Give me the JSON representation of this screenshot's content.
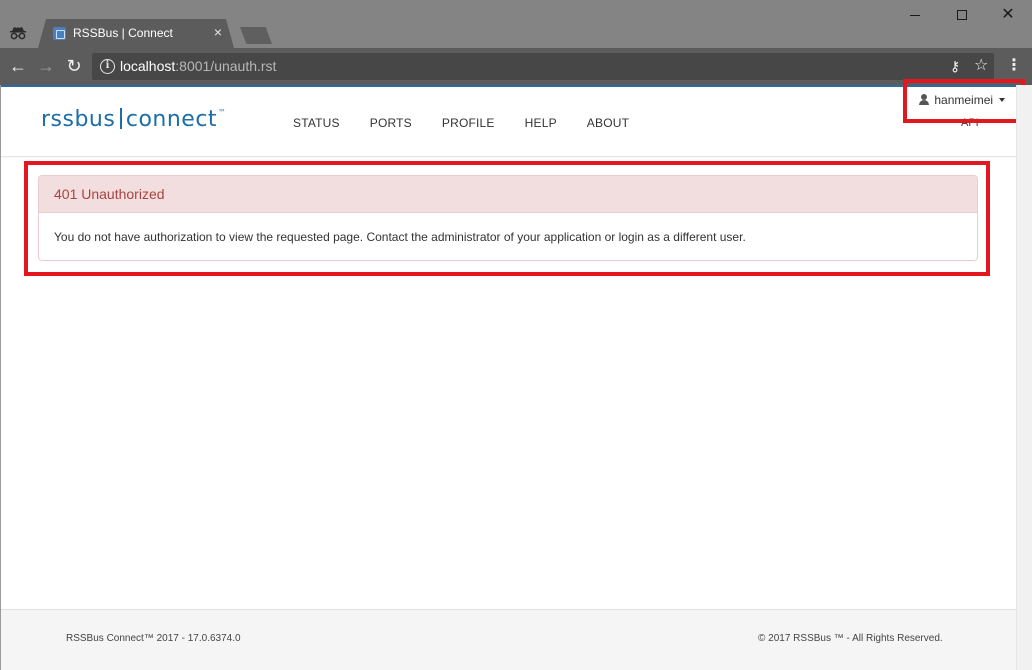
{
  "browser": {
    "tab_title": "RSSBus | Connect",
    "tab_close": "×",
    "url_host": "localhost",
    "url_rest": ":8001/unauth.rst",
    "win_close": "✕",
    "back": "←",
    "forward": "→",
    "reload": "↻",
    "info": "i",
    "key": "⚷",
    "star": "☆",
    "menu": "⋮"
  },
  "site": {
    "logo_left": "rssbus",
    "logo_right": "connect",
    "logo_tm": "™",
    "nav": [
      "STATUS",
      "PORTS",
      "PROFILE",
      "HELP",
      "ABOUT"
    ],
    "api": "API",
    "user": "hanmeimei"
  },
  "alert": {
    "title": "401 Unauthorized",
    "message": "You do not have authorization to view the requested page. Contact the administrator of your application or login as a different user."
  },
  "footer": {
    "left": "RSSBus Connect™ 2017 - 17.0.6374.0",
    "right": "© 2017 RSSBus ™ - All Rights Reserved."
  },
  "colors": {
    "brand": "#1d6ea8",
    "alert_text": "#a94442",
    "alert_bg": "#f2dede",
    "highlight": "#e3171f"
  }
}
